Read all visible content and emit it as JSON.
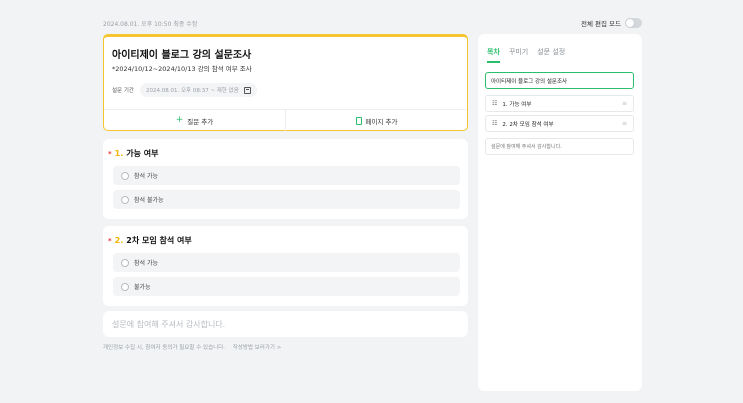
{
  "topbar": {
    "modified": "2024.08.01. 오후 10:50 최종 수정",
    "edit_mode_label": "전체 편집 모드"
  },
  "header": {
    "title": "아이티제이 블로그 강의 설문조사",
    "description": "*2024/10/12~2024/10/13 강의 참석 여부 조사",
    "period_label": "설문 기간",
    "period_value": "2024.08.01. 오후 08:37 ~ 제한 없음",
    "add_question": "질문 추가",
    "add_page": "페이지 추가"
  },
  "questions": [
    {
      "required_mark": "*",
      "number": "1.",
      "title": "가능 여부",
      "options": [
        "참석 가능",
        "참석 불가능"
      ]
    },
    {
      "required_mark": "*",
      "number": "2.",
      "title": "2차 모임 참석 여부",
      "options": [
        "참석 가능",
        "불가능"
      ]
    }
  ],
  "end_message": "설문에 참여해 주셔서 감사합니다.",
  "footnote": {
    "text": "개인정보 수집 시, 참여자 동의가 필요할 수 있습니다.",
    "link": "작성방법 보러가기 >"
  },
  "panel": {
    "tabs": [
      "목차",
      "꾸미기",
      "설문 설정"
    ],
    "toc_title": "아이티제이 블로그 강의 설문조사",
    "toc_items": [
      "1. 가능 여부",
      "2. 2차 모임 참석 여부"
    ],
    "toc_end": "설문에 참여해 주셔서 감사합니다."
  },
  "colors": {
    "accent": "#2bbf6b",
    "header_border": "#f4c431",
    "number_color": "#f4b400",
    "required_color": "#e53935"
  }
}
